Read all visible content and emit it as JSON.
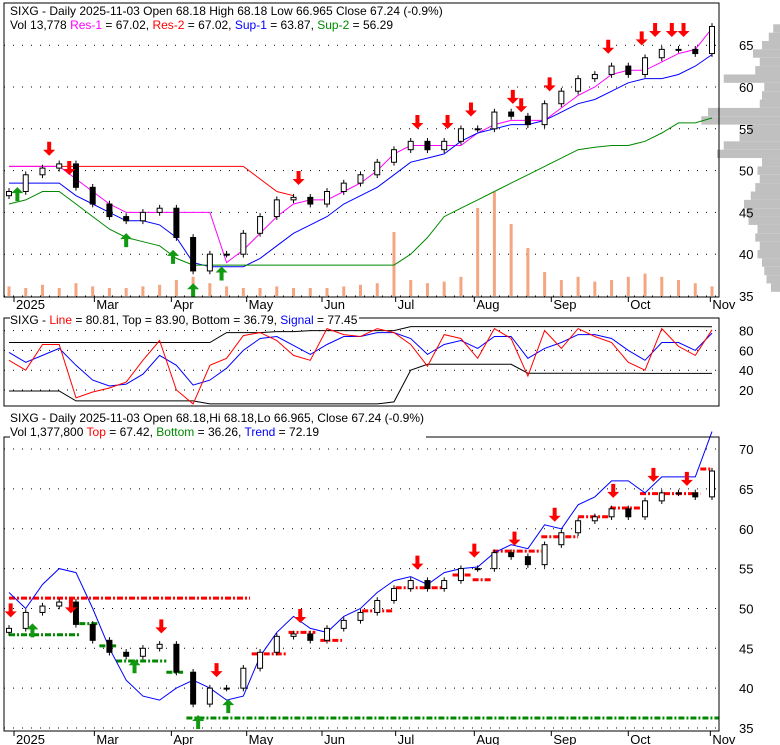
{
  "header_top": {
    "line1": "SIXG - Daily 2025-11-03 Open 68.18  High 68.18  Low 66.965  Close 67.24 (-0.9%)",
    "vol": "Vol 13,778",
    "res1_label": "Res-1",
    "res1": " = 67.02, ",
    "res2_label": "Res-2",
    "res2": " = 67.02, ",
    "sup1_label": "Sup-1",
    "sup1": " = 63.87, ",
    "sup2_label": "Sup-2",
    "sup2": " = 56.29"
  },
  "header_mid": {
    "prefix": "SIXG - ",
    "line_label": "Line",
    "line": " = 80.81, Top = 83.90, Bottom = 36.79, ",
    "signal_label": "Signal",
    "signal": " = 77.45"
  },
  "header_bot": {
    "line1": "SIXG - Daily 2025-11-03 Open 68.18,Hi 68.18,Lo 66.965, Close 67.24 (-0.9%)",
    "vol": "Vol 1,377,800 ",
    "top_label": "Top",
    "top": " = 67.42, ",
    "bottom_label": "Bottom",
    "bottom": " = 36.26, ",
    "trend_label": "Trend",
    "trend": " = 72.19"
  },
  "colors": {
    "res1": "#ff00ff",
    "res2": "#ff0000",
    "sup1": "#0000ff",
    "sup2": "#008800",
    "volume": "#f4a582",
    "profile": "#c0c0c0",
    "sell": "#ff0000",
    "buy": "#119911"
  },
  "chart_data": {
    "type": "candlestick",
    "months": [
      {
        "label": "2025",
        "i": 0.3
      },
      {
        "label": "Mar",
        "i": 5.1
      },
      {
        "label": "Apr",
        "i": 9.7
      },
      {
        "label": "May",
        "i": 14.2
      },
      {
        "label": "Jun",
        "i": 18.7
      },
      {
        "label": "Jul",
        "i": 23.1
      },
      {
        "label": "Aug",
        "i": 27.8
      },
      {
        "label": "Sep",
        "i": 32.4
      },
      {
        "label": "Oct",
        "i": 37
      },
      {
        "label": "Nov",
        "i": 41.9
      }
    ],
    "close": [
      47.5,
      49.5,
      50.3,
      50.8,
      48,
      46,
      44.5,
      44,
      45,
      45.5,
      42,
      38,
      40,
      40,
      42.5,
      44.5,
      46.5,
      46.8,
      46,
      47.5,
      48.5,
      49.5,
      51,
      52.5,
      53.5,
      52.5,
      53.5,
      55,
      55,
      57,
      56.5,
      55.5,
      58,
      59.5,
      61,
      61.5,
      62.5,
      61.5,
      63.5,
      64.5,
      64.5,
      64,
      67.24
    ],
    "volume_relative": [
      6,
      5,
      7,
      5,
      8,
      6,
      5,
      5,
      6,
      7,
      10,
      12,
      8,
      6,
      5,
      5,
      6,
      5,
      5,
      5,
      6,
      7,
      8,
      40,
      10,
      8,
      9,
      12,
      55,
      65,
      45,
      30,
      15,
      10,
      12,
      9,
      10,
      12,
      14,
      12,
      10,
      8,
      6
    ],
    "price_axis_top": [
      65,
      60,
      55,
      50,
      45,
      40,
      35
    ],
    "price_axis_bottom": [
      70,
      65,
      60,
      55,
      50,
      45,
      40,
      35
    ],
    "osc_axis": [
      80,
      60,
      40,
      20
    ],
    "res1": [
      50.5,
      50.5,
      50.5,
      50.5,
      49,
      47.5,
      46,
      45,
      45,
      45,
      45,
      45,
      45,
      39,
      40.5,
      42.5,
      44.5,
      46,
      46.5,
      46.5,
      47.5,
      48.5,
      50,
      52,
      53,
      53,
      53,
      53,
      54.5,
      55.5,
      56,
      56,
      56,
      57.5,
      59,
      60,
      61.5,
      62,
      62,
      63,
      64,
      64.5,
      67.02
    ],
    "res2": [
      50.5,
      50.5,
      50.5,
      50.5,
      50.5,
      50.5,
      50.5,
      50.5,
      50.5,
      50.5,
      50.5,
      50.5,
      50.5,
      50.5,
      50.5,
      49,
      47.5,
      47,
      null,
      null,
      null,
      null,
      null,
      null,
      null,
      null,
      null,
      null,
      null,
      null,
      null,
      null,
      null,
      null,
      null,
      null,
      null,
      null,
      null,
      null,
      null,
      null,
      null
    ],
    "sup1": [
      48.5,
      48.5,
      48.5,
      48.5,
      47,
      46,
      45,
      44,
      44,
      43.5,
      42,
      39,
      38.5,
      38.5,
      38.5,
      39.5,
      41,
      42.5,
      43.5,
      44.5,
      46,
      47,
      48,
      49.5,
      51,
      51.5,
      52,
      53.5,
      54.5,
      55,
      55.5,
      55.5,
      56,
      57,
      58,
      58.5,
      59.5,
      60.5,
      61,
      61,
      61.5,
      62.5,
      63.87
    ],
    "sup2": [
      46,
      46.5,
      47.5,
      47.5,
      46,
      44.5,
      43,
      42,
      41.5,
      41,
      39.5,
      38.7,
      38.7,
      38.7,
      38.7,
      38.7,
      38.7,
      38.7,
      38.7,
      38.7,
      38.7,
      38.7,
      38.7,
      38.7,
      40,
      42,
      44.5,
      45.5,
      46.5,
      47.5,
      48.5,
      49.5,
      50.5,
      51.5,
      52.5,
      52.8,
      53,
      53,
      53.5,
      54.5,
      55.7,
      55.7,
      56.29
    ],
    "volume_profile": [
      {
        "p": 36,
        "v": 20
      },
      {
        "p": 37,
        "v": 30
      },
      {
        "p": 38,
        "v": 35
      },
      {
        "p": 39,
        "v": 40
      },
      {
        "p": 40,
        "v": 50
      },
      {
        "p": 41,
        "v": 45
      },
      {
        "p": 42,
        "v": 55
      },
      {
        "p": 43,
        "v": 50
      },
      {
        "p": 44,
        "v": 70
      },
      {
        "p": 45,
        "v": 75
      },
      {
        "p": 46,
        "v": 80
      },
      {
        "p": 47,
        "v": 65
      },
      {
        "p": 48,
        "v": 55
      },
      {
        "p": 49,
        "v": 45
      },
      {
        "p": 50,
        "v": 50
      },
      {
        "p": 51,
        "v": 40
      },
      {
        "p": 52,
        "v": 140
      },
      {
        "p": 53,
        "v": 125
      },
      {
        "p": 54,
        "v": 90
      },
      {
        "p": 55,
        "v": 70
      },
      {
        "p": 56,
        "v": 175
      },
      {
        "p": 57,
        "v": 160
      },
      {
        "p": 58,
        "v": 45
      },
      {
        "p": 59,
        "v": 40
      },
      {
        "p": 60,
        "v": 35
      },
      {
        "p": 61,
        "v": 125
      },
      {
        "p": 62,
        "v": 55
      },
      {
        "p": 63,
        "v": 45
      },
      {
        "p": 64,
        "v": 60
      },
      {
        "p": 65,
        "v": 40
      },
      {
        "p": 66,
        "v": 25
      },
      {
        "p": 67,
        "v": 15
      }
    ],
    "signals_top": [
      {
        "i": 2.4,
        "t": "sell"
      },
      {
        "i": 3.6,
        "t": "sell"
      },
      {
        "i": 17.3,
        "t": "sell"
      },
      {
        "i": 24.4,
        "t": "sell"
      },
      {
        "i": 26.2,
        "t": "sell"
      },
      {
        "i": 27.6,
        "t": "sell"
      },
      {
        "i": 30.1,
        "t": "sell"
      },
      {
        "i": 30.6,
        "t": "sell"
      },
      {
        "i": 32.3,
        "t": "sell"
      },
      {
        "i": 35.8,
        "t": "sell"
      },
      {
        "i": 37.8,
        "t": "sell"
      },
      {
        "i": 38.6,
        "t": "sell"
      },
      {
        "i": 39.6,
        "t": "sell"
      },
      {
        "i": 40.3,
        "t": "sell"
      },
      {
        "i": 0.5,
        "t": "buy"
      },
      {
        "i": 7,
        "t": "buy"
      },
      {
        "i": 9.8,
        "t": "buy"
      },
      {
        "i": 11,
        "t": "buy"
      },
      {
        "i": 12.7,
        "t": "buy"
      }
    ],
    "osc_line": [
      50,
      40,
      66,
      66,
      12,
      18,
      22,
      28,
      50,
      70,
      20,
      6,
      45,
      52,
      75,
      78,
      70,
      55,
      50,
      82,
      76,
      74,
      82,
      78,
      66,
      44,
      76,
      72,
      52,
      82,
      72,
      34,
      80,
      62,
      82,
      74,
      68,
      48,
      40,
      82,
      64,
      55,
      80.81
    ],
    "osc_signal": [
      58,
      48,
      55,
      62,
      45,
      30,
      24,
      26,
      36,
      55,
      45,
      25,
      30,
      42,
      60,
      72,
      74,
      65,
      56,
      66,
      74,
      74,
      78,
      78,
      72,
      56,
      66,
      70,
      62,
      74,
      74,
      52,
      62,
      68,
      76,
      76,
      72,
      60,
      50,
      68,
      68,
      60,
      77.45
    ],
    "osc_top": [
      68,
      68,
      68,
      68,
      68,
      68,
      68,
      68,
      68,
      68,
      68,
      68,
      68,
      78,
      78,
      78,
      79,
      79,
      80,
      80,
      80,
      80,
      80,
      80,
      84,
      84,
      84,
      84,
      84,
      84,
      84,
      84,
      84,
      84,
      84,
      84,
      84,
      84,
      84,
      84,
      84,
      84,
      83.9
    ],
    "osc_bottom": [
      19,
      19,
      19,
      19,
      9,
      9,
      9,
      9,
      9,
      9,
      9,
      9,
      6,
      6,
      6,
      6,
      6,
      6,
      6,
      6,
      6,
      6,
      6,
      8,
      40,
      46,
      46,
      46,
      46,
      46,
      46,
      37,
      37,
      37,
      37,
      37,
      37,
      37,
      36.8,
      36.8,
      36.8,
      36.8,
      36.79
    ],
    "trend": [
      52,
      50,
      53,
      55,
      54.5,
      50,
      45,
      41,
      39,
      38.5,
      40,
      41,
      40,
      38.5,
      39,
      44,
      47,
      49,
      47.5,
      47,
      49,
      50,
      52,
      53.5,
      54,
      53,
      54.5,
      55,
      55.2,
      57,
      58,
      57.5,
      60.5,
      60,
      63,
      64,
      66,
      66,
      64.5,
      66.5,
      66.5,
      66.5,
      72.19
    ],
    "resistance_levels": [
      {
        "from": 0,
        "to": 14.4,
        "p": 51.3
      },
      {
        "from": 14.5,
        "to": 16.6,
        "p": 44.3
      },
      {
        "from": 16.7,
        "to": 18.3,
        "p": 47
      },
      {
        "from": 18.6,
        "to": 19.9,
        "p": 46
      },
      {
        "from": 21.1,
        "to": 22.9,
        "p": 49.7
      },
      {
        "from": 23.1,
        "to": 26,
        "p": 52.6
      },
      {
        "from": 26.5,
        "to": 27.6,
        "p": 54.2
      },
      {
        "from": 27.7,
        "to": 28.8,
        "p": 53.6
      },
      {
        "from": 28.9,
        "to": 31.8,
        "p": 57.2
      },
      {
        "from": 31.8,
        "to": 34,
        "p": 59
      },
      {
        "from": 34,
        "to": 35.9,
        "p": 61.5
      },
      {
        "from": 35.9,
        "to": 37.7,
        "p": 62.6
      },
      {
        "from": 37.7,
        "to": 41.3,
        "p": 64.4
      },
      {
        "from": 41.3,
        "to": 42,
        "p": 67.5
      }
    ],
    "support_levels": [
      {
        "from": 0,
        "to": 4.2,
        "p": 46.7
      },
      {
        "from": 4.2,
        "to": 5.4,
        "p": 48.1
      },
      {
        "from": 5.4,
        "to": 6.4,
        "p": 45.3
      },
      {
        "from": 6.4,
        "to": 9.4,
        "p": 43.4
      },
      {
        "from": 9.4,
        "to": 10.4,
        "p": 42
      },
      {
        "from": 10.6,
        "to": 42.4,
        "p": 36.26
      }
    ],
    "signals_bottom": [
      {
        "i": 0.1,
        "t": "sell"
      },
      {
        "i": 3.7,
        "t": "sell"
      },
      {
        "i": 9.1,
        "t": "sell"
      },
      {
        "i": 12.4,
        "t": "sell"
      },
      {
        "i": 17.4,
        "t": "sell"
      },
      {
        "i": 24.4,
        "t": "sell"
      },
      {
        "i": 27.8,
        "t": "sell"
      },
      {
        "i": 30.2,
        "t": "sell"
      },
      {
        "i": 32.6,
        "t": "sell"
      },
      {
        "i": 36.1,
        "t": "sell"
      },
      {
        "i": 38.5,
        "t": "sell"
      },
      {
        "i": 40.5,
        "t": "sell"
      },
      {
        "i": 1.4,
        "t": "buy"
      },
      {
        "i": 7.5,
        "t": "buy"
      },
      {
        "i": 11.3,
        "t": "buy"
      },
      {
        "i": 13.1,
        "t": "buy"
      }
    ]
  }
}
